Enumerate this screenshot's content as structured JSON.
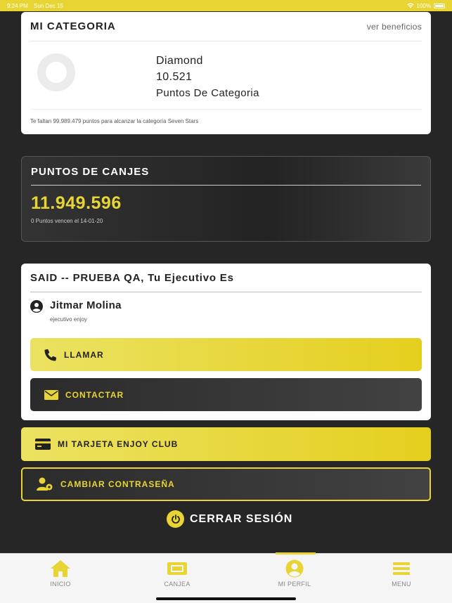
{
  "status_bar": {
    "time": "9:24 PM",
    "date": "Sun Dec 15",
    "battery": "100%"
  },
  "category": {
    "title": "MI CATEGORIA",
    "link": "ver beneficios",
    "name": "Diamond",
    "points": "10.521",
    "points_label": "Puntos De Categoria",
    "note": "Te faltan 99.989.479 puntos para alcanzar la categoría Seven Stars"
  },
  "redeem": {
    "title": "PUNTOS DE CANJES",
    "points": "11.949.596",
    "expiry": "0 Puntos vencen el 14-01-20"
  },
  "executive": {
    "title": "SAID -- PRUEBA QA, Tu Ejecutivo Es",
    "name": "Jitmar Molina",
    "role": "ejecutivo enjoy",
    "call_label": "LLAMAR",
    "contact_label": "CONTACTAR"
  },
  "actions": {
    "card_label": "MI TARJETA ENJOY CLUB",
    "password_label": "CAMBIAR CONTRASEÑA",
    "logout_label": "CERRAR SESIÓN"
  },
  "tabs": [
    {
      "label": "INICIO",
      "icon": "home-icon"
    },
    {
      "label": "CANJEA",
      "icon": "ticket-icon"
    },
    {
      "label": "MI PERFIL",
      "icon": "profile-icon",
      "active": true
    },
    {
      "label": "MENU",
      "icon": "menu-icon"
    }
  ],
  "colors": {
    "accent": "#e8d534",
    "background": "#262626"
  }
}
